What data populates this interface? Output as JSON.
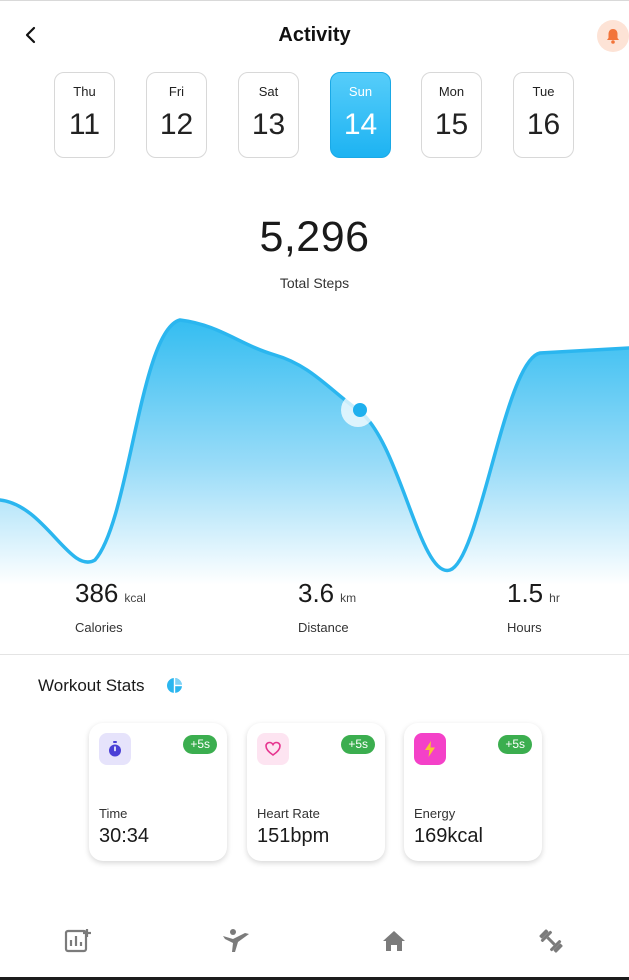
{
  "header": {
    "title": "Activity",
    "back_icon": "chevron-left-icon",
    "notification_icon": "bell-icon"
  },
  "days": [
    {
      "name": "Thu",
      "num": "11"
    },
    {
      "name": "Fri",
      "num": "12"
    },
    {
      "name": "Sat",
      "num": "13"
    },
    {
      "name": "Sun",
      "num": "14",
      "active": true
    },
    {
      "name": "Mon",
      "num": "15"
    },
    {
      "name": "Tue",
      "num": "16"
    }
  ],
  "summary": {
    "steps": "5,296",
    "steps_label": "Total Steps"
  },
  "metrics": [
    {
      "value": "386",
      "unit": "kcal",
      "label": "Calories"
    },
    {
      "value": "3.6",
      "unit": "km",
      "label": "Distance"
    },
    {
      "value": "1.5",
      "unit": "hr",
      "label": "Hours"
    }
  ],
  "workout": {
    "title": "Workout Stats",
    "cards": [
      {
        "label": "Time",
        "value": "30:34",
        "badge": "+5s",
        "icon": "stopwatch-icon"
      },
      {
        "label": "Heart Rate",
        "value": "151bpm",
        "badge": "+5s",
        "icon": "heart-icon"
      },
      {
        "label": "Energy",
        "value": "169kcal",
        "badge": "+5s",
        "icon": "lightning-icon"
      }
    ]
  },
  "nav": {
    "items": [
      "stats-icon",
      "exercise-icon",
      "home-icon",
      "dumbbell-icon"
    ]
  },
  "colors": {
    "accent": "#1db3f2",
    "badge": "#3bae4f",
    "bell_bg": "#fde3d6",
    "bell": "#f2743a"
  }
}
